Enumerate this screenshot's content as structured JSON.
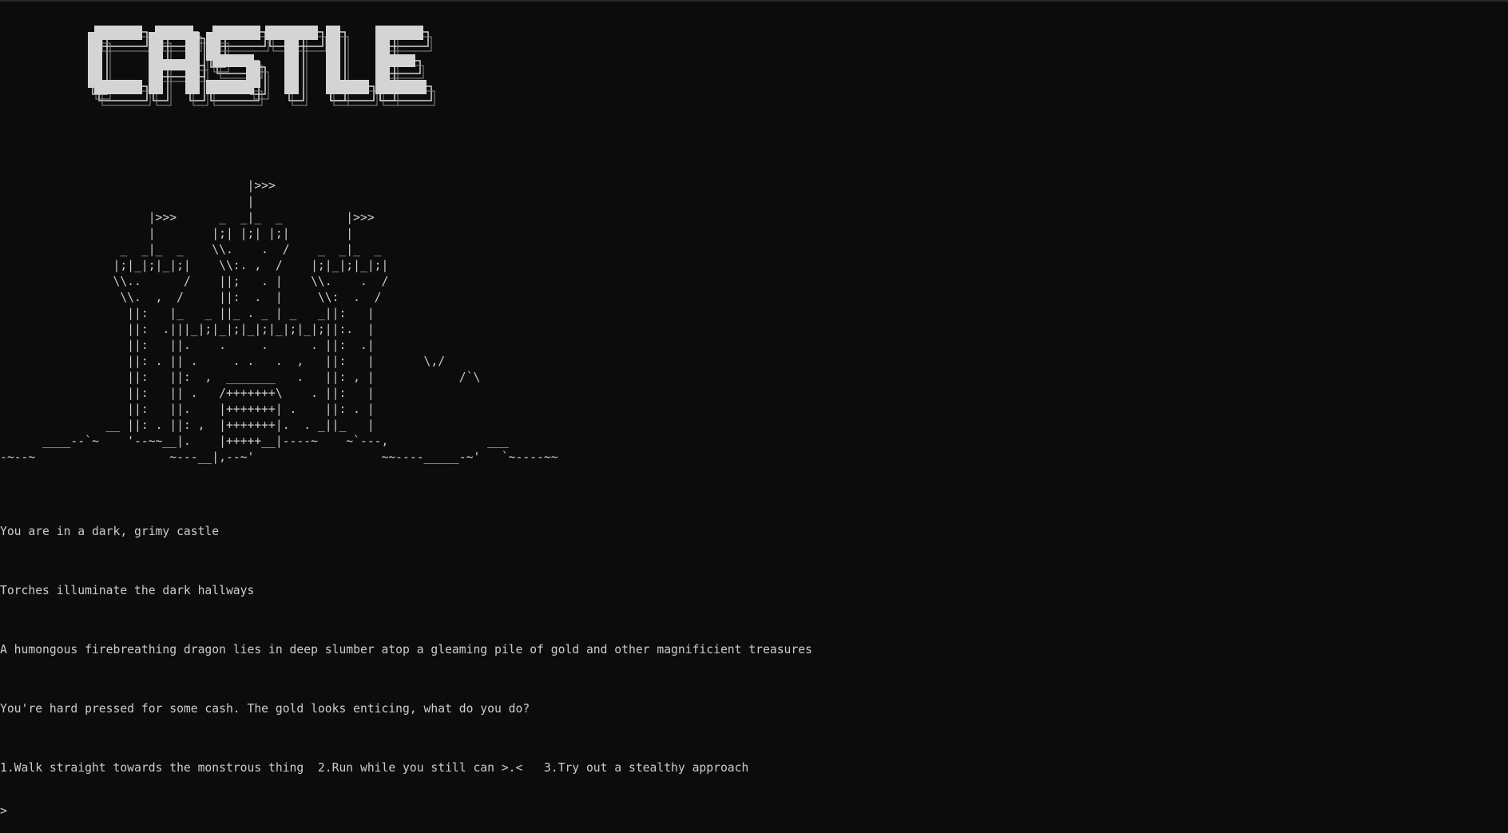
{
  "title": {
    "text": "CASTLE"
  },
  "art": {
    "lines": [
      "                                   |>>>",
      "                                   |",
      "                     |>>>      _  _|_  _         |>>>",
      "                     |        |;| |;| |;|        |",
      "                 _  _|_  _    \\\\.    .  /    _  _|_  _",
      "                |;|_|;|_|;|    \\\\:. ,  /    |;|_|;|_|;|",
      "                \\\\..      /    ||;   . |    \\\\.    .  /",
      "                 \\\\.  ,  /     ||:  .  |     \\\\:  .  /",
      "                  ||:   |_   _ ||_ . _ | _   _||:   |",
      "                  ||:  .|||_|;|_|;|_|;|_|;|_|;||:.  |",
      "                  ||:   ||.    .     .      . ||:  .|",
      "                  ||: . || .     . .   .  ,   ||:   |       \\,/",
      "                  ||:   ||:  ,  _______   .   ||: , |            /`\\",
      "                  ||:   || .   /+++++++\\    . ||:   |",
      "                  ||:   ||.    |+++++++| .    ||: . |",
      "               __ ||: . ||: ,  |+++++++|.  . _||_   |",
      "      ____--`~    '--~~__|.    |+++++__|----~    ~`---,              ___",
      "-~--~                   ~---__|,--~'                  ~~----_____-~'   `~----~~"
    ]
  },
  "story": {
    "lines": [
      "You are in a dark, grimy castle",
      "Torches illuminate the dark hallways",
      "A humongous firebreathing dragon lies in deep slumber atop a gleaming pile of gold and other magnificient treasures",
      "You're hard pressed for some cash. The gold looks enticing, what do you do?"
    ],
    "choices": "1.Walk straight towards the monstrous thing  2.Run while you still can >.<   3.Try out a stealthy approach",
    "prompt": ">",
    "input_value": ""
  },
  "colors": {
    "background": "#0c0c0c",
    "text": "#cccccc",
    "logo_fill": "#d4d4d4"
  }
}
